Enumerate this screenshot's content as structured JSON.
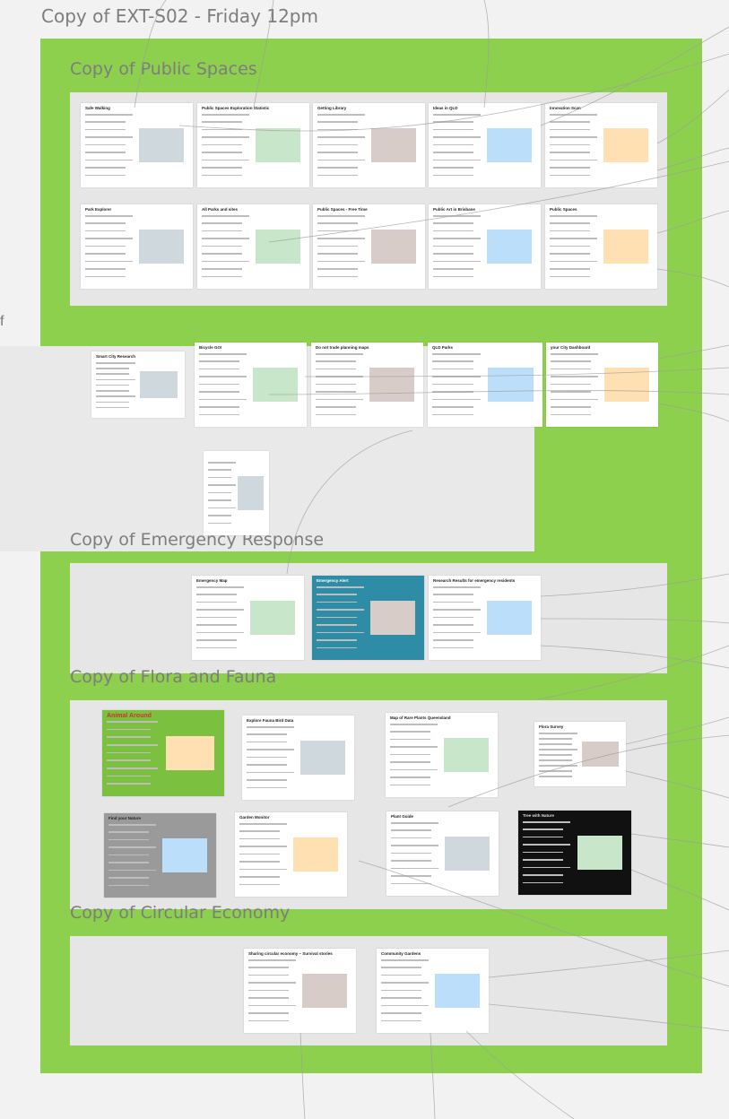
{
  "board": {
    "title": "Copy of EXT-S02 - Friday 12pm"
  },
  "side": {
    "glyph": "f"
  },
  "groups": [
    {
      "id": "public-spaces",
      "title": "Copy of Public Spaces"
    },
    {
      "id": "emergency-response",
      "title": "Copy of Emergency Response"
    },
    {
      "id": "flora-and-fauna",
      "title": "Copy of Flora and Fauna"
    },
    {
      "id": "circular-economy",
      "title": "Copy of Circular Economy"
    }
  ],
  "cards": {
    "ps": [
      "Safe Walking",
      "Public Spaces Exploration Statistic",
      "Getting Library",
      "Ideas in QLD",
      "Innovation Scan",
      "Park Explorer",
      "All Parks and sites",
      "Public Spaces - Free Time",
      "Public Art in Brisbane",
      "Public Spaces"
    ],
    "row": [
      "Smart City Research",
      "Bicycle GO!",
      "Do not trade planning maps",
      "QLD Parks",
      "your City Dashboard"
    ],
    "em": [
      "Emergency Map",
      "Emergency Alert",
      "Research Results for emergency residents"
    ],
    "ff": [
      "Animal Around",
      "Explore Fauna Bird Data",
      "Map of Rare Plants Queensland",
      "Flora Survey",
      "Find your Nature",
      "Garden Monitor",
      "Plant Guide",
      "Tree with Nature"
    ],
    "ce": [
      "Sharing circular economy – Survival stories",
      "Community Gardens"
    ]
  },
  "colors": {
    "frame_green": "#8dd04d",
    "panel_gray": "#e6e6e6",
    "title_gray": "#7d7d7d",
    "canvas": "#f2f2f2"
  }
}
